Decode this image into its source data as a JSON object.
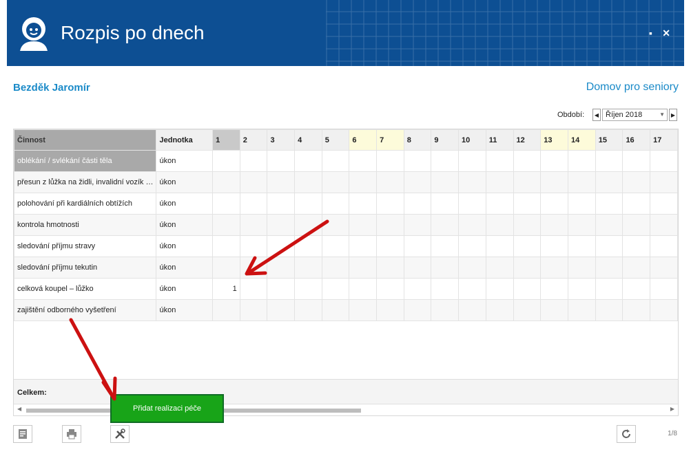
{
  "window": {
    "title": "Rozpis po dnech",
    "maximize_label": "▪",
    "close_label": "✕"
  },
  "patient_name": "Bezděk Jaromír",
  "facility": "Domov pro seniory",
  "period": {
    "label": "Období:",
    "value": "Říjen 2018"
  },
  "grid": {
    "headers": {
      "activity": "Činnost",
      "unit": "Jednotka",
      "days": [
        "1",
        "2",
        "3",
        "4",
        "5",
        "6",
        "7",
        "8",
        "9",
        "10",
        "11",
        "12",
        "13",
        "14",
        "15",
        "16",
        "17"
      ]
    },
    "rows": [
      {
        "activity": "oblékání / svlékání části těla",
        "unit": "úkon",
        "day1": ""
      },
      {
        "activity": "přesun z lůžka na židli, invalidní vozík …",
        "unit": "úkon",
        "day1": ""
      },
      {
        "activity": "polohování při kardiálních obtížích",
        "unit": "úkon",
        "day1": ""
      },
      {
        "activity": "kontrola hmotnosti",
        "unit": "úkon",
        "day1": ""
      },
      {
        "activity": "sledování příjmu stravy",
        "unit": "úkon",
        "day1": ""
      },
      {
        "activity": "sledování příjmu tekutin",
        "unit": "úkon",
        "day1": ""
      },
      {
        "activity": "celková koupel – lůžko",
        "unit": "úkon",
        "day1": "1"
      },
      {
        "activity": "zajištění odborného vyšetření",
        "unit": "úkon",
        "day1": ""
      }
    ],
    "total_label": "Celkem:"
  },
  "tooltip": "Přidat realizaci péče",
  "pager": "1/8",
  "icons": [
    "user-avatar-icon",
    "maximize-icon",
    "close-icon",
    "prev-icon",
    "next-icon",
    "dropdown-icon",
    "note-icon",
    "print-icon",
    "tools-icon",
    "refresh-icon"
  ],
  "colors": {
    "header": "#0d4f93",
    "accent": "#1a8ac8",
    "tooltip": "#18a418",
    "weekend": "#fdfbda",
    "arrow": "#cc1111"
  }
}
